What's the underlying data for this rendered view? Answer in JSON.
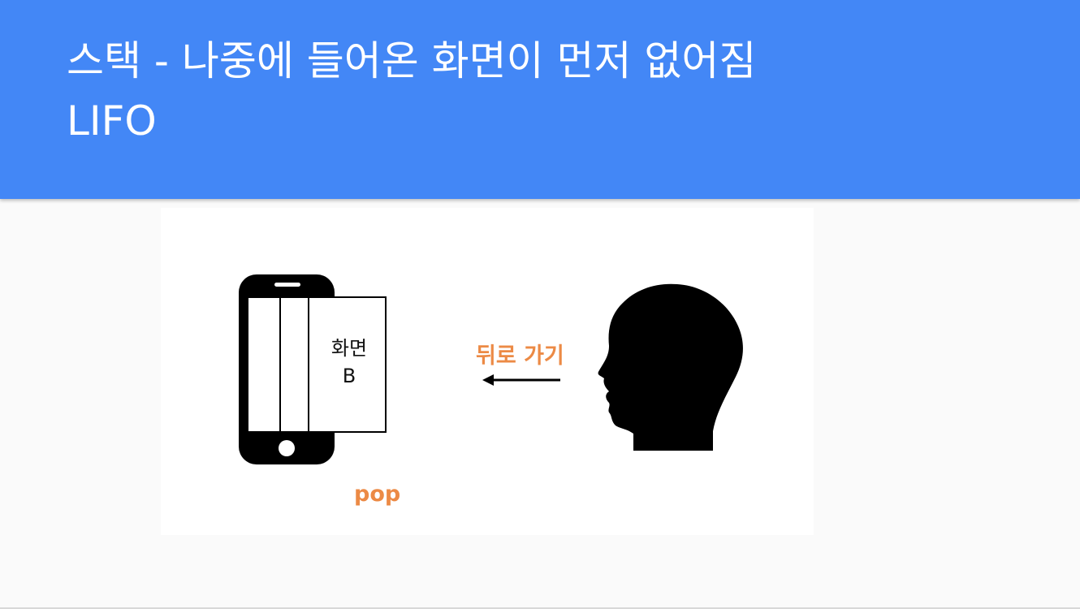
{
  "slide": {
    "title_line1": "스택 - 나중에 들어온 화면이 먼저 없어짐",
    "title_line2": "LIFO"
  },
  "diagram": {
    "screen_label_line1": "화면",
    "screen_label_line2": "B",
    "back_label": "뒤로 가기",
    "pop_label": "pop",
    "icons": [
      "smartphone-icon",
      "head-silhouette-icon",
      "arrow-left-icon"
    ]
  },
  "colors": {
    "header_bg": "#4387f6",
    "accent_orange": "#ec8a45",
    "background": "#fafafa"
  }
}
